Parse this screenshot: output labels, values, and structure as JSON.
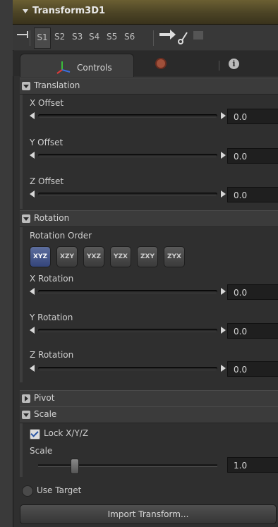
{
  "node": {
    "title": "Transform3D1"
  },
  "toolbar": {
    "slots": [
      "S1",
      "S2",
      "S3",
      "S4",
      "S5",
      "S6"
    ],
    "active_slot": "S1"
  },
  "tabs": [
    {
      "label": "Controls",
      "icon": "axes-icon",
      "active": true
    },
    {
      "label": "",
      "icon": "gear-icon"
    },
    {
      "label": "",
      "icon": "info-icon"
    }
  ],
  "translation": {
    "header": "Translation",
    "x": {
      "label": "X Offset",
      "value": "0.0"
    },
    "y": {
      "label": "Y Offset",
      "value": "0.0"
    },
    "z": {
      "label": "Z Offset",
      "value": "0.0"
    }
  },
  "rotation": {
    "header": "Rotation",
    "order_label": "Rotation Order",
    "orders": [
      "XYZ",
      "XZY",
      "YXZ",
      "YZX",
      "ZXY",
      "ZYX"
    ],
    "selected_order": "XYZ",
    "x": {
      "label": "X Rotation",
      "value": "0.0"
    },
    "y": {
      "label": "Y Rotation",
      "value": "0.0"
    },
    "z": {
      "label": "Z Rotation",
      "value": "0.0"
    }
  },
  "pivot": {
    "header": "Pivot"
  },
  "scale": {
    "header": "Scale",
    "lock_label": "Lock X/Y/Z",
    "lock_checked": true,
    "label": "Scale",
    "value": "1.0"
  },
  "use_target": {
    "label": "Use Target"
  },
  "import_button": {
    "label": "Import Transform..."
  },
  "colors": {
    "header_bg": "#5a4f2b",
    "selected_button": "#3f5088",
    "panel_bg": "#2f2f2f"
  }
}
